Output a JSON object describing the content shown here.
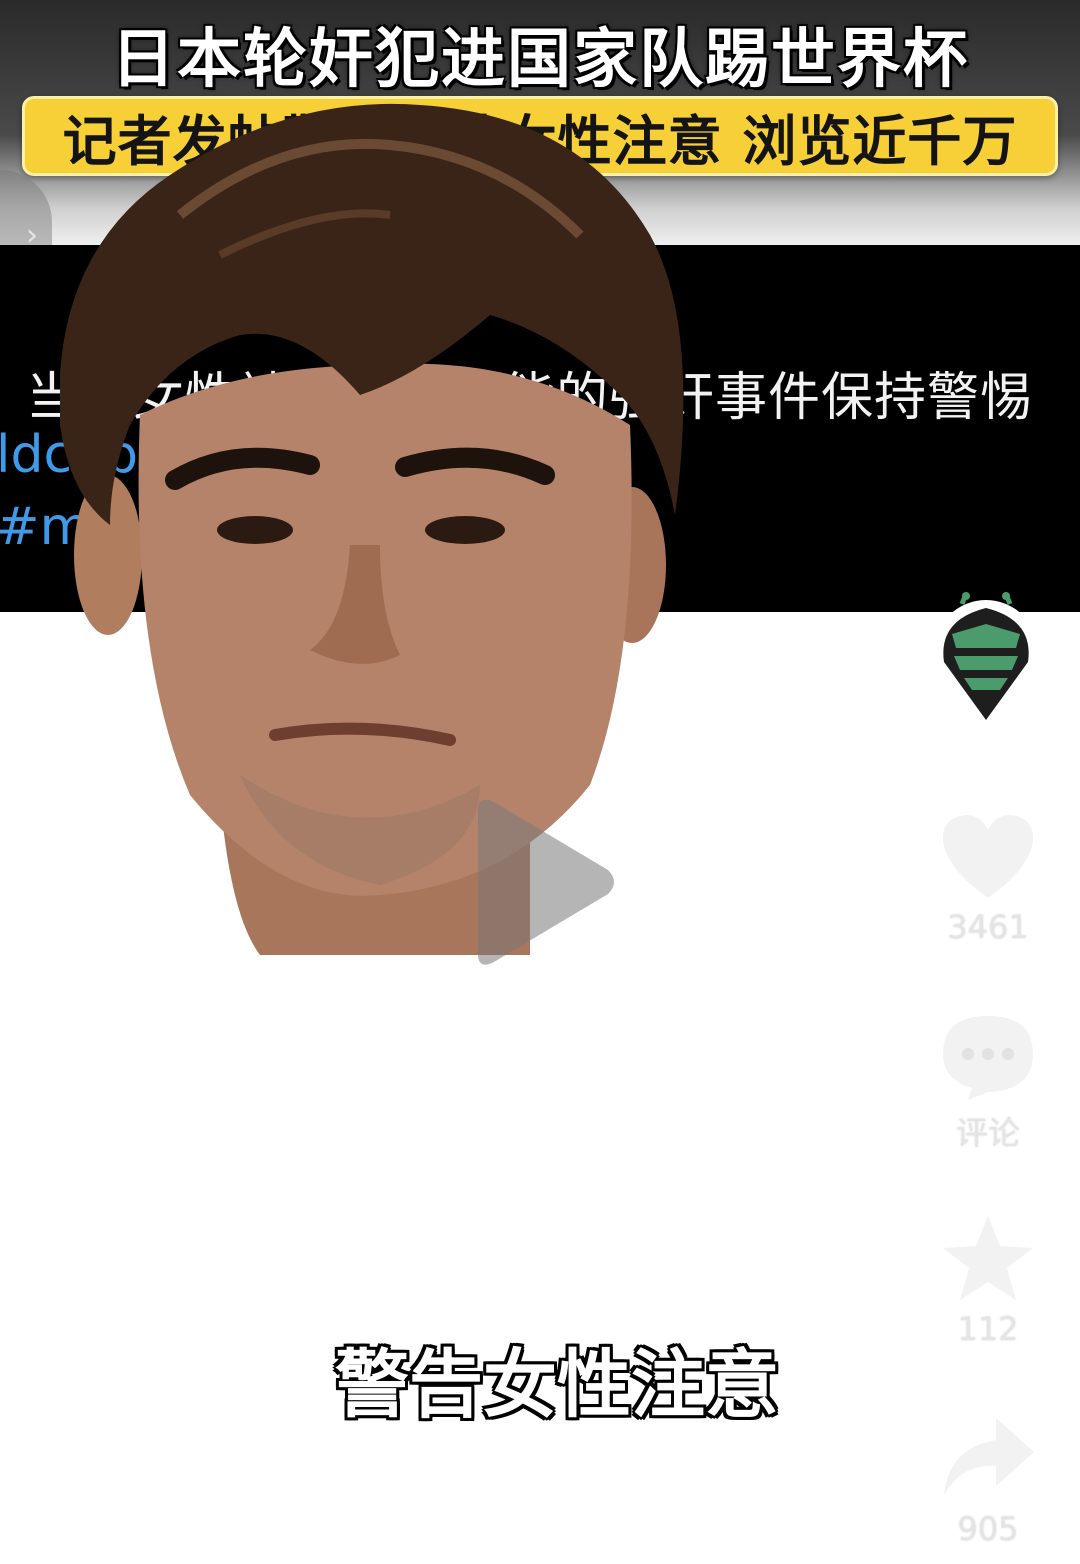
{
  "banner": {
    "title": "日本轮奸犯进国家队踢世界杯",
    "subtitle": "记者发帖警告当地女性注意 浏览近千万"
  },
  "tweet": {
    "text": "当地女性被敦促对可能的强奸事件保持警惕",
    "hashtags": [
      "ldcup",
      "#mexico"
    ],
    "hashtag_color": "#3f9be9"
  },
  "video": {
    "caption": "警告女性注意"
  },
  "actions": {
    "like_count": "3461",
    "comment_label": "评论",
    "favorite_count": "112",
    "share_count": "905"
  },
  "icons": {
    "back": "chevron-right-icon",
    "play": "play-icon",
    "like": "heart-icon",
    "comment": "comment-bubble-icon",
    "favorite": "star-icon",
    "share": "share-arrow-icon",
    "avatar": "bee-avatar"
  },
  "colors": {
    "subtitle_bg": "#f7cf37",
    "avatar_green": "#4b9b6d"
  }
}
